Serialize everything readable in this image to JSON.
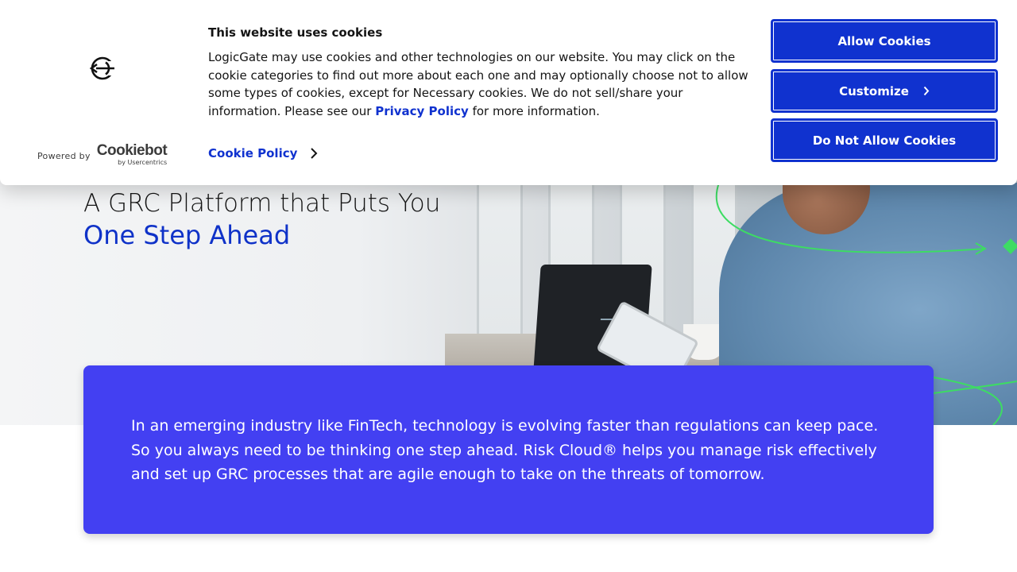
{
  "cookie_banner": {
    "heading": "This website uses cookies",
    "body_text": "LogicGate may use cookies and other technologies on our website. You may click on the cookie categories to find out more about each one and may optionally choose not to allow some types of cookies, except for Necessary cookies.  We do not sell/share your information. Please see our ",
    "privacy_link": "Privacy Policy",
    "body_suffix": " for more information.",
    "cookie_policy_link": "Cookie Policy",
    "powered_by": "Powered by",
    "cookiebot_brand": "Cookiebot",
    "cookiebot_sub": "by Usercentrics",
    "buttons": {
      "allow": "Allow Cookies",
      "customize": "Customize",
      "deny": "Do Not Allow Cookies"
    }
  },
  "hero": {
    "title": "A GRC Platform that Puts You",
    "subtitle": "One Step Ahead"
  },
  "intro_card": {
    "text": "In an emerging industry like FinTech, technology is evolving faster than regulations can keep pace. So you always need to be thinking one step ahead. Risk Cloud® helps you manage risk effectively and set up GRC processes that are agile enough to take on the threats of tomorrow."
  },
  "colors": {
    "brand_blue": "#1032cf",
    "card_purple": "#4340f2",
    "accent_green": "#3ddc63"
  },
  "icons": {
    "site_logo": "logicgate-logo-icon",
    "chevron": "chevron-right-icon"
  }
}
